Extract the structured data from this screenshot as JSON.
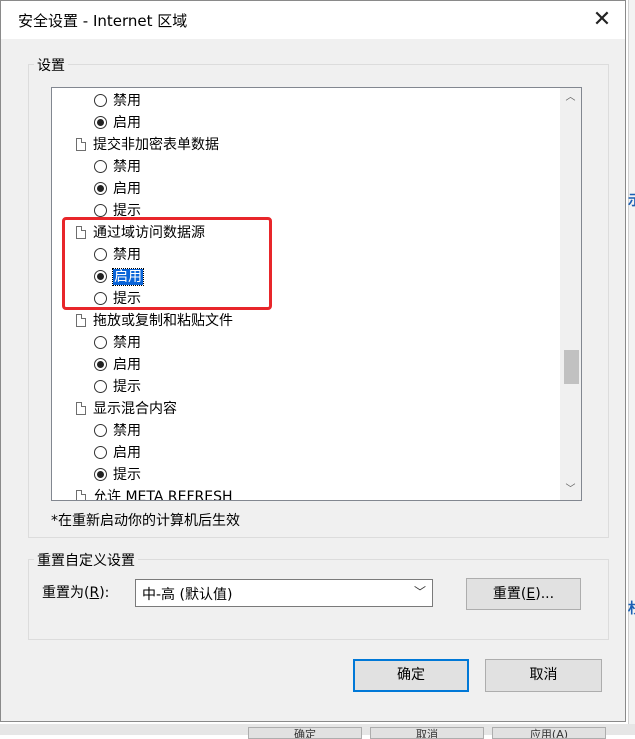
{
  "window": {
    "title": "安全设置 - Internet 区域",
    "close_glyph": "✕"
  },
  "settings_group": {
    "legend": "设置"
  },
  "settings_list": {
    "rows": [
      {
        "type": "option",
        "label": "禁用",
        "checked": false
      },
      {
        "type": "option",
        "label": "启用",
        "checked": true
      },
      {
        "type": "setting",
        "label": "提交非加密表单数据"
      },
      {
        "type": "option",
        "label": "禁用",
        "checked": false
      },
      {
        "type": "option",
        "label": "启用",
        "checked": true
      },
      {
        "type": "option",
        "label": "提示",
        "checked": false
      },
      {
        "type": "setting",
        "label": "通过域访问数据源"
      },
      {
        "type": "option",
        "label": "禁用",
        "checked": false
      },
      {
        "type": "option",
        "label": "启用",
        "checked": true,
        "selected": true
      },
      {
        "type": "option",
        "label": "提示",
        "checked": false
      },
      {
        "type": "setting",
        "label": "拖放或复制和粘贴文件"
      },
      {
        "type": "option",
        "label": "禁用",
        "checked": false
      },
      {
        "type": "option",
        "label": "启用",
        "checked": true
      },
      {
        "type": "option",
        "label": "提示",
        "checked": false
      },
      {
        "type": "setting",
        "label": "显示混合内容"
      },
      {
        "type": "option",
        "label": "禁用",
        "checked": false
      },
      {
        "type": "option",
        "label": "启用",
        "checked": false
      },
      {
        "type": "option",
        "label": "提示",
        "checked": true
      },
      {
        "type": "setting",
        "label": "允许 META REFRESH"
      }
    ],
    "scroll_up_glyph": "︿",
    "scroll_down_glyph": "﹀",
    "highlight_color": "#e8262a"
  },
  "restart_note": "*在重新启动你的计算机后生效",
  "reset_group": {
    "legend": "重置自定义设置",
    "reset_to_label": "重置为",
    "reset_to_accel": "R",
    "reset_to_suffix": "):",
    "select_value": "中-高 (默认值)",
    "reset_button": "重置",
    "reset_button_accel": "E",
    "reset_button_suffix": ")..."
  },
  "footer": {
    "ok_label": "确定",
    "cancel_label": "取消"
  },
  "background": {
    "side_char_1": "示",
    "side_char_2": "杉",
    "btn_1": "确定",
    "btn_2": "取消",
    "btn_3": "应用(A)"
  }
}
